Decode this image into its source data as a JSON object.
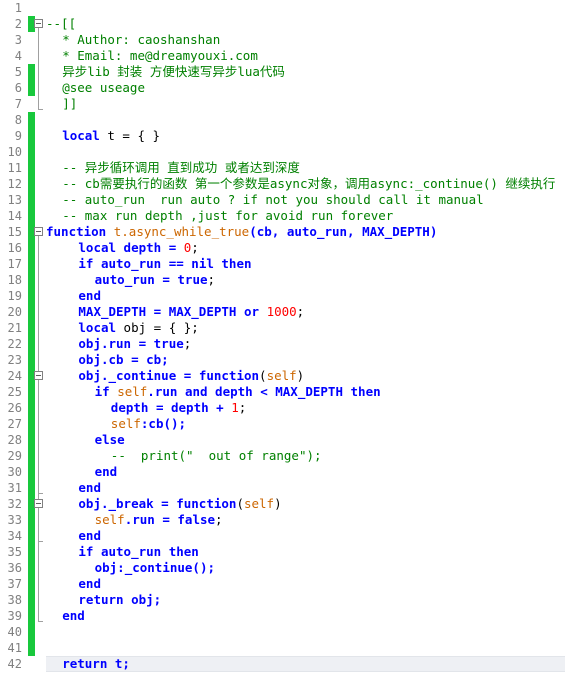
{
  "editor": {
    "language": "Lua",
    "line_height": 16,
    "first_line": 1,
    "last_line": 42,
    "current_line": 42,
    "colors": {
      "background": "#ffffff",
      "line_number": "#808080",
      "change_bar": "#18c83c",
      "fold_guide": "#a0a0a0",
      "current_line_highlight": "#eef0f4",
      "comment": "#008000",
      "keyword": "#0000ff",
      "number": "#ff0000",
      "string": "#808080",
      "self_identifier": "#cc6600",
      "plain_text": "#000000"
    }
  },
  "line_numbers": [
    1,
    2,
    3,
    4,
    5,
    6,
    7,
    8,
    9,
    10,
    11,
    12,
    13,
    14,
    15,
    16,
    17,
    18,
    19,
    20,
    21,
    22,
    23,
    24,
    25,
    26,
    27,
    28,
    29,
    30,
    31,
    32,
    33,
    34,
    35,
    36,
    37,
    38,
    39,
    40,
    41,
    42
  ],
  "change_bars": [
    {
      "from_line": 2,
      "to_line": 2
    },
    {
      "from_line": 5,
      "to_line": 6
    },
    {
      "from_line": 8,
      "to_line": 41
    }
  ],
  "fold_boxes": [
    {
      "line": 2,
      "state": "expanded",
      "glyph": "minus"
    },
    {
      "line": 15,
      "state": "expanded",
      "glyph": "minus"
    },
    {
      "line": 24,
      "state": "expanded",
      "glyph": "minus"
    },
    {
      "line": 32,
      "state": "expanded",
      "glyph": "minus"
    }
  ],
  "fold_guides": [
    {
      "from_line": 2,
      "to_line": 7
    },
    {
      "from_line": 15,
      "to_line": 39
    },
    {
      "from_line": 24,
      "to_line": 31
    },
    {
      "from_line": 32,
      "to_line": 34
    }
  ],
  "code_lines": [
    {
      "n": 1,
      "indent": 0,
      "tokens": []
    },
    {
      "n": 2,
      "indent": 0,
      "tokens": [
        {
          "t": "--[[",
          "c": "comment"
        }
      ]
    },
    {
      "n": 3,
      "indent": 1,
      "tokens": [
        {
          "t": "* Author: caoshanshan",
          "c": "comment"
        }
      ]
    },
    {
      "n": 4,
      "indent": 1,
      "tokens": [
        {
          "t": "* Email: me@dreamyouxi.com",
          "c": "comment"
        }
      ]
    },
    {
      "n": 5,
      "indent": 1,
      "tokens": [
        {
          "t": "异步lib 封装 方便快速写异步lua代码",
          "c": "comment"
        }
      ]
    },
    {
      "n": 6,
      "indent": 1,
      "tokens": [
        {
          "t": "@see useage",
          "c": "comment"
        }
      ]
    },
    {
      "n": 7,
      "indent": 1,
      "tokens": [
        {
          "t": "]]",
          "c": "comment"
        }
      ]
    },
    {
      "n": 8,
      "indent": 0,
      "tokens": []
    },
    {
      "n": 9,
      "indent": 1,
      "tokens": [
        {
          "t": "local",
          "c": "keyword"
        },
        {
          "t": " t = { }",
          "c": "plain"
        }
      ]
    },
    {
      "n": 10,
      "indent": 0,
      "tokens": []
    },
    {
      "n": 11,
      "indent": 1,
      "tokens": [
        {
          "t": "-- 异步循环调用 直到成功 或者达到深度",
          "c": "comment"
        }
      ]
    },
    {
      "n": 12,
      "indent": 1,
      "tokens": [
        {
          "t": "-- cb需要执行的函数 第一个参数是async对象，调用async:_continue() 继续执行",
          "c": "comment"
        }
      ]
    },
    {
      "n": 13,
      "indent": 1,
      "tokens": [
        {
          "t": "-- auto_run  run auto ? if not you should call it manual",
          "c": "comment"
        }
      ]
    },
    {
      "n": 14,
      "indent": 1,
      "tokens": [
        {
          "t": "-- max run depth ,just for avoid run forever",
          "c": "comment"
        }
      ]
    },
    {
      "n": 15,
      "indent": 0,
      "tokens": [
        {
          "t": "function",
          "c": "keyword"
        },
        {
          "t": " ",
          "c": "plain"
        },
        {
          "t": "t.async_while_true",
          "c": "func"
        },
        {
          "t": "(cb, auto_run, MAX_DEPTH)",
          "c": "keyword"
        }
      ]
    },
    {
      "n": 16,
      "indent": 2,
      "tokens": [
        {
          "t": "local",
          "c": "keyword"
        },
        {
          "t": " depth = ",
          "c": "keyword"
        },
        {
          "t": "0",
          "c": "number"
        },
        {
          "t": ";",
          "c": "plain"
        }
      ]
    },
    {
      "n": 17,
      "indent": 2,
      "tokens": [
        {
          "t": "if",
          "c": "keyword"
        },
        {
          "t": " auto_run == ",
          "c": "keyword"
        },
        {
          "t": "nil",
          "c": "keyword"
        },
        {
          "t": " ",
          "c": "plain"
        },
        {
          "t": "then",
          "c": "keyword"
        }
      ]
    },
    {
      "n": 18,
      "indent": 3,
      "tokens": [
        {
          "t": "auto_run = ",
          "c": "keyword"
        },
        {
          "t": "true",
          "c": "keyword"
        },
        {
          "t": ";",
          "c": "plain"
        }
      ]
    },
    {
      "n": 19,
      "indent": 2,
      "tokens": [
        {
          "t": "end",
          "c": "keyword"
        }
      ]
    },
    {
      "n": 20,
      "indent": 2,
      "tokens": [
        {
          "t": "MAX_DEPTH = MAX_DEPTH ",
          "c": "keyword"
        },
        {
          "t": "or",
          "c": "keyword"
        },
        {
          "t": " ",
          "c": "plain"
        },
        {
          "t": "1000",
          "c": "number"
        },
        {
          "t": ";",
          "c": "plain"
        }
      ]
    },
    {
      "n": 21,
      "indent": 2,
      "tokens": [
        {
          "t": "local",
          "c": "keyword"
        },
        {
          "t": " obj = { };",
          "c": "plain"
        }
      ]
    },
    {
      "n": 22,
      "indent": 2,
      "tokens": [
        {
          "t": "obj.run = ",
          "c": "keyword"
        },
        {
          "t": "true",
          "c": "keyword"
        },
        {
          "t": ";",
          "c": "plain"
        }
      ]
    },
    {
      "n": 23,
      "indent": 2,
      "tokens": [
        {
          "t": "obj.cb = cb;",
          "c": "keyword"
        }
      ]
    },
    {
      "n": 24,
      "indent": 2,
      "tokens": [
        {
          "t": "obj._continue = ",
          "c": "keyword"
        },
        {
          "t": "function",
          "c": "keyword"
        },
        {
          "t": "(",
          "c": "plain"
        },
        {
          "t": "self",
          "c": "self"
        },
        {
          "t": ")",
          "c": "plain"
        }
      ]
    },
    {
      "n": 25,
      "indent": 3,
      "tokens": [
        {
          "t": "if",
          "c": "keyword"
        },
        {
          "t": " ",
          "c": "plain"
        },
        {
          "t": "self",
          "c": "self"
        },
        {
          "t": ".run ",
          "c": "keyword"
        },
        {
          "t": "and",
          "c": "keyword"
        },
        {
          "t": " depth < MAX_DEPTH ",
          "c": "keyword"
        },
        {
          "t": "then",
          "c": "keyword"
        }
      ]
    },
    {
      "n": 26,
      "indent": 4,
      "tokens": [
        {
          "t": "depth = depth + ",
          "c": "keyword"
        },
        {
          "t": "1",
          "c": "number"
        },
        {
          "t": ";",
          "c": "plain"
        }
      ]
    },
    {
      "n": 27,
      "indent": 4,
      "tokens": [
        {
          "t": "self",
          "c": "self"
        },
        {
          "t": ":cb();",
          "c": "keyword"
        }
      ]
    },
    {
      "n": 28,
      "indent": 3,
      "tokens": [
        {
          "t": "else",
          "c": "keyword"
        }
      ]
    },
    {
      "n": 29,
      "indent": 4,
      "tokens": [
        {
          "t": "--  print(\"  out of range\");",
          "c": "comment"
        }
      ]
    },
    {
      "n": 30,
      "indent": 3,
      "tokens": [
        {
          "t": "end",
          "c": "keyword"
        }
      ]
    },
    {
      "n": 31,
      "indent": 2,
      "tokens": [
        {
          "t": "end",
          "c": "keyword"
        }
      ]
    },
    {
      "n": 32,
      "indent": 2,
      "tokens": [
        {
          "t": "obj._break = ",
          "c": "keyword"
        },
        {
          "t": "function",
          "c": "keyword"
        },
        {
          "t": "(",
          "c": "plain"
        },
        {
          "t": "self",
          "c": "self"
        },
        {
          "t": ")",
          "c": "plain"
        }
      ]
    },
    {
      "n": 33,
      "indent": 3,
      "tokens": [
        {
          "t": "self",
          "c": "self"
        },
        {
          "t": ".run = ",
          "c": "keyword"
        },
        {
          "t": "false",
          "c": "keyword"
        },
        {
          "t": ";",
          "c": "plain"
        }
      ]
    },
    {
      "n": 34,
      "indent": 2,
      "tokens": [
        {
          "t": "end",
          "c": "keyword"
        }
      ]
    },
    {
      "n": 35,
      "indent": 2,
      "tokens": [
        {
          "t": "if",
          "c": "keyword"
        },
        {
          "t": " auto_run ",
          "c": "keyword"
        },
        {
          "t": "then",
          "c": "keyword"
        }
      ]
    },
    {
      "n": 36,
      "indent": 3,
      "tokens": [
        {
          "t": "obj:_continue();",
          "c": "keyword"
        }
      ]
    },
    {
      "n": 37,
      "indent": 2,
      "tokens": [
        {
          "t": "end",
          "c": "keyword"
        }
      ]
    },
    {
      "n": 38,
      "indent": 2,
      "tokens": [
        {
          "t": "return",
          "c": "keyword"
        },
        {
          "t": " obj;",
          "c": "keyword"
        }
      ]
    },
    {
      "n": 39,
      "indent": 1,
      "tokens": [
        {
          "t": "end",
          "c": "keyword"
        }
      ]
    },
    {
      "n": 40,
      "indent": 0,
      "tokens": []
    },
    {
      "n": 41,
      "indent": 0,
      "tokens": []
    },
    {
      "n": 42,
      "indent": 1,
      "tokens": [
        {
          "t": "return",
          "c": "keyword"
        },
        {
          "t": " t;",
          "c": "keyword"
        }
      ]
    }
  ]
}
